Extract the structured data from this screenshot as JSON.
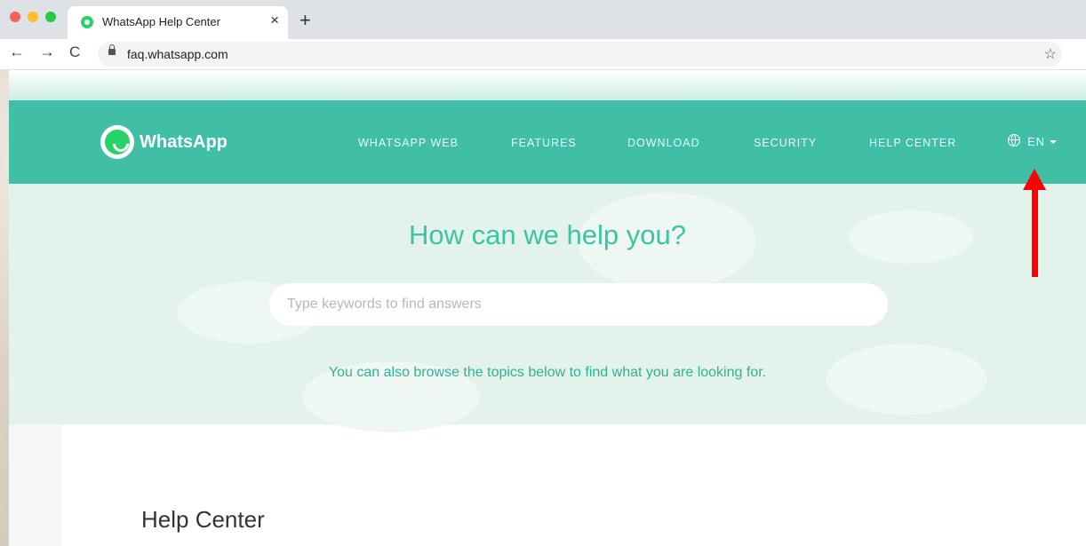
{
  "browser": {
    "tab_title": "WhatsApp Help Center",
    "tab_close": "×",
    "new_tab": "+",
    "back": "←",
    "forward": "→",
    "reload": "C",
    "url": "faq.whatsapp.com",
    "bookmark": "☆"
  },
  "header": {
    "brand": "WhatsApp",
    "nav": [
      "WHATSAPP WEB",
      "FEATURES",
      "DOWNLOAD",
      "SECURITY",
      "HELP CENTER"
    ],
    "language": "EN"
  },
  "hero": {
    "title": "How can we help you?",
    "search_placeholder": "Type keywords to find answers",
    "subtitle": "You can also browse the topics below to find what you are looking for."
  },
  "content": {
    "heading": "Help Center"
  },
  "colors": {
    "header": "#40bea6",
    "accent": "#3cc4a3",
    "annotation": "#ff0000"
  }
}
